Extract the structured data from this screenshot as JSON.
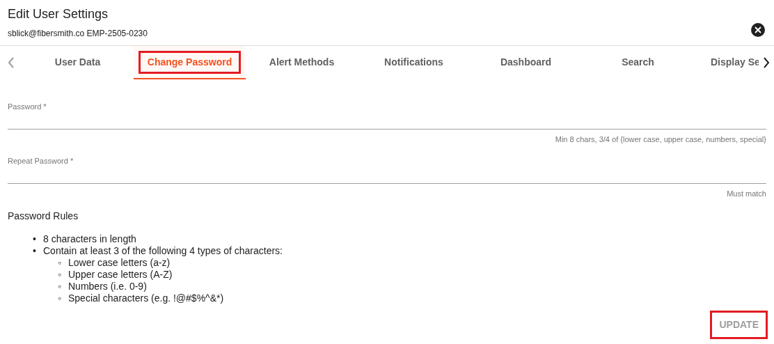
{
  "dialog": {
    "title": "Edit User Settings",
    "subtitle": "sblick@fibersmith.co EMP-2505-0230"
  },
  "tabs": [
    {
      "label": "User Data",
      "selected": false,
      "highlighted": false
    },
    {
      "label": "Change Password",
      "selected": true,
      "highlighted": true
    },
    {
      "label": "Alert Methods",
      "selected": false,
      "highlighted": false
    },
    {
      "label": "Notifications",
      "selected": false,
      "highlighted": false
    },
    {
      "label": "Dashboard",
      "selected": false,
      "highlighted": false
    },
    {
      "label": "Search",
      "selected": false,
      "highlighted": false
    },
    {
      "label": "Display Se",
      "selected": false,
      "highlighted": false
    }
  ],
  "fields": [
    {
      "label": "Password *",
      "hint": "Min 8 chars, 3/4 of {lower case, upper case, numbers, special}"
    },
    {
      "label": "Repeat Password *",
      "hint": "Must match"
    }
  ],
  "rules": {
    "title": "Password Rules",
    "items": [
      {
        "marker": "•",
        "text": "8 characters in length"
      },
      {
        "marker": "•",
        "text": "Contain at least 3 of the following 4 types of characters:",
        "children": [
          {
            "marker": "◦",
            "text": "Lower case letters (a-z)"
          },
          {
            "marker": "◦",
            "text": "Upper case letters (A-Z)"
          },
          {
            "marker": "◦",
            "text": "Numbers (i.e. 0-9)"
          },
          {
            "marker": "◦",
            "text": "Special characters (e.g. !@#$%^&*)"
          }
        ]
      }
    ]
  },
  "update_button": {
    "label": "UPDATE",
    "disabled": true,
    "highlighted": true
  }
}
